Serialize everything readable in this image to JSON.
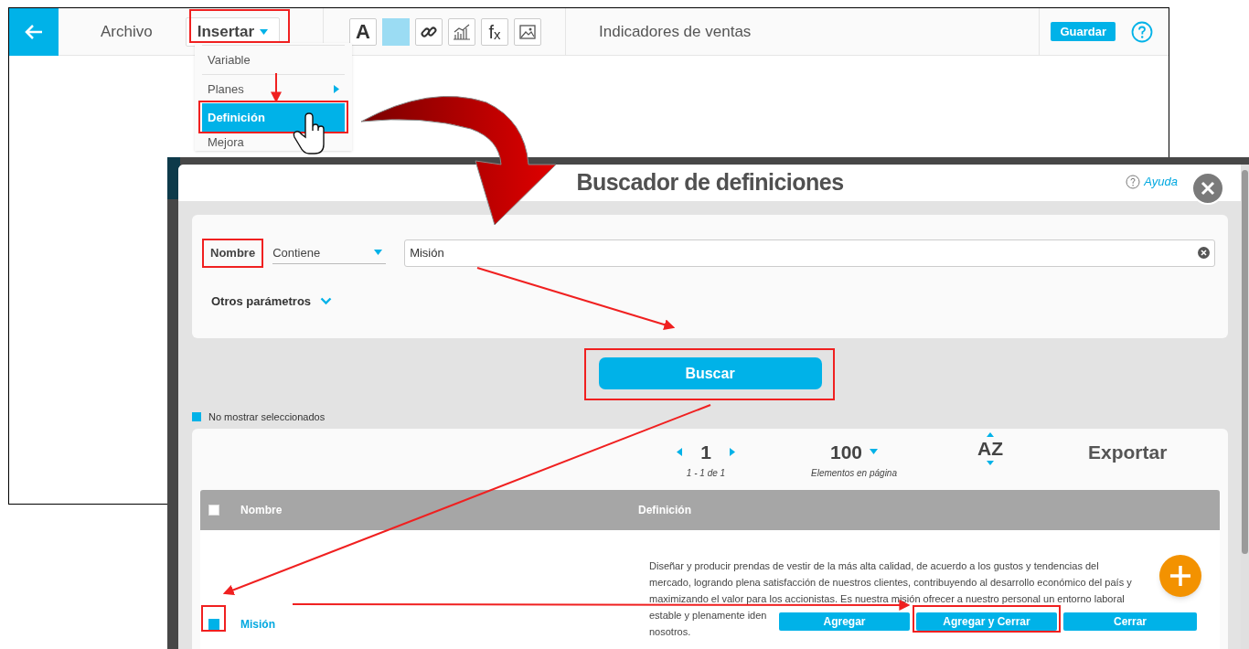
{
  "app": {
    "menu": [
      {
        "label": "Archivo",
        "expanded": false
      },
      {
        "label": "Insertar",
        "expanded": true
      }
    ],
    "toolbar": [
      {
        "kind": "text",
        "label": "A"
      },
      {
        "kind": "color",
        "color": "#9bdcf3"
      },
      {
        "kind": "link"
      },
      {
        "kind": "chart"
      },
      {
        "kind": "formula",
        "label": "f$_{x}$"
      },
      {
        "kind": "image"
      }
    ],
    "document_title": "Indicadores de ventas",
    "save_button": "Guardar",
    "dropdown": [
      {
        "label": "Variable",
        "selected": false,
        "submenu": false
      },
      {
        "label": "Planes",
        "selected": false,
        "submenu": true
      },
      {
        "label": "Definición",
        "selected": true,
        "submenu": false
      },
      {
        "label": "Mejora",
        "selected": false,
        "submenu": false
      }
    ]
  },
  "modal": {
    "title": "Buscador de definiciones",
    "help": "Ayuda",
    "search": {
      "field_label": "Nombre",
      "operator": "Contiene",
      "value": "Misión",
      "more_params": "Otros parámetros"
    },
    "search_button": "Buscar",
    "hide_selected": {
      "label": "No mostrar seleccionados",
      "checked": true
    },
    "pagination": {
      "page": "1",
      "range": "1 - 1 de 1",
      "page_size": "100",
      "page_size_label": "Elementos en página"
    },
    "sort": "AZ",
    "export": "Exportar",
    "table": {
      "columns": [
        "Nombre",
        "Definición"
      ],
      "header_checked": false,
      "rows": [
        {
          "checked": true,
          "name": "Misión",
          "definition_lines": [
            "Diseñar y producir prendas de vestir de la más alta calidad, de acuerdo a los gustos y tendencias del",
            "mercado, logrando plena satisfacción de nuestros clientes, contribuyendo al desarrollo económico del país y",
            "maximizando el valor para los accionistas. Es nuestra misión ofrecer a nuestro personal un entorno laboral",
            "estable y plenamente iden",
            "nosotros."
          ]
        }
      ]
    },
    "actions": [
      "Agregar",
      "Agregar y Cerrar",
      "Cerrar"
    ]
  }
}
